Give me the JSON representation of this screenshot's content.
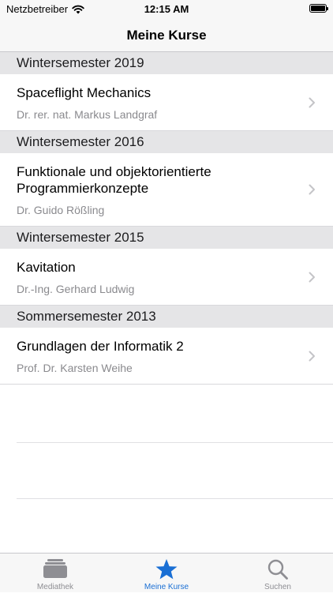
{
  "status_bar": {
    "carrier": "Netzbetreiber",
    "time": "12:15 AM"
  },
  "nav": {
    "title": "Meine Kurse"
  },
  "sections": [
    {
      "header": "Wintersemester 2019",
      "items": [
        {
          "title": "Spaceflight Mechanics",
          "subtitle": "Dr. rer. nat. Markus Landgraf"
        }
      ]
    },
    {
      "header": "Wintersemester 2016",
      "items": [
        {
          "title": "Funktionale und objektorientierte Programmierkonzepte",
          "subtitle": "Dr. Guido Rößling"
        }
      ]
    },
    {
      "header": "Wintersemester 2015",
      "items": [
        {
          "title": "Kavitation",
          "subtitle": "Dr.-Ing. Gerhard Ludwig"
        }
      ]
    },
    {
      "header": "Sommersemester 2013",
      "items": [
        {
          "title": "Grundlagen der Informatik 2",
          "subtitle": "Prof. Dr. Karsten Weihe"
        }
      ]
    }
  ],
  "tab_bar": {
    "tabs": [
      {
        "label": "Mediathek",
        "icon": "books-stack-icon",
        "active": false
      },
      {
        "label": "Meine Kurse",
        "icon": "star-icon",
        "active": true
      },
      {
        "label": "Suchen",
        "icon": "magnifier-icon",
        "active": false
      }
    ]
  },
  "colors": {
    "accent": "#1a6fd4",
    "section_header_bg": "#e5e5e7",
    "subtitle": "#8a8a8e",
    "tab_inactive": "#8e8e93"
  }
}
